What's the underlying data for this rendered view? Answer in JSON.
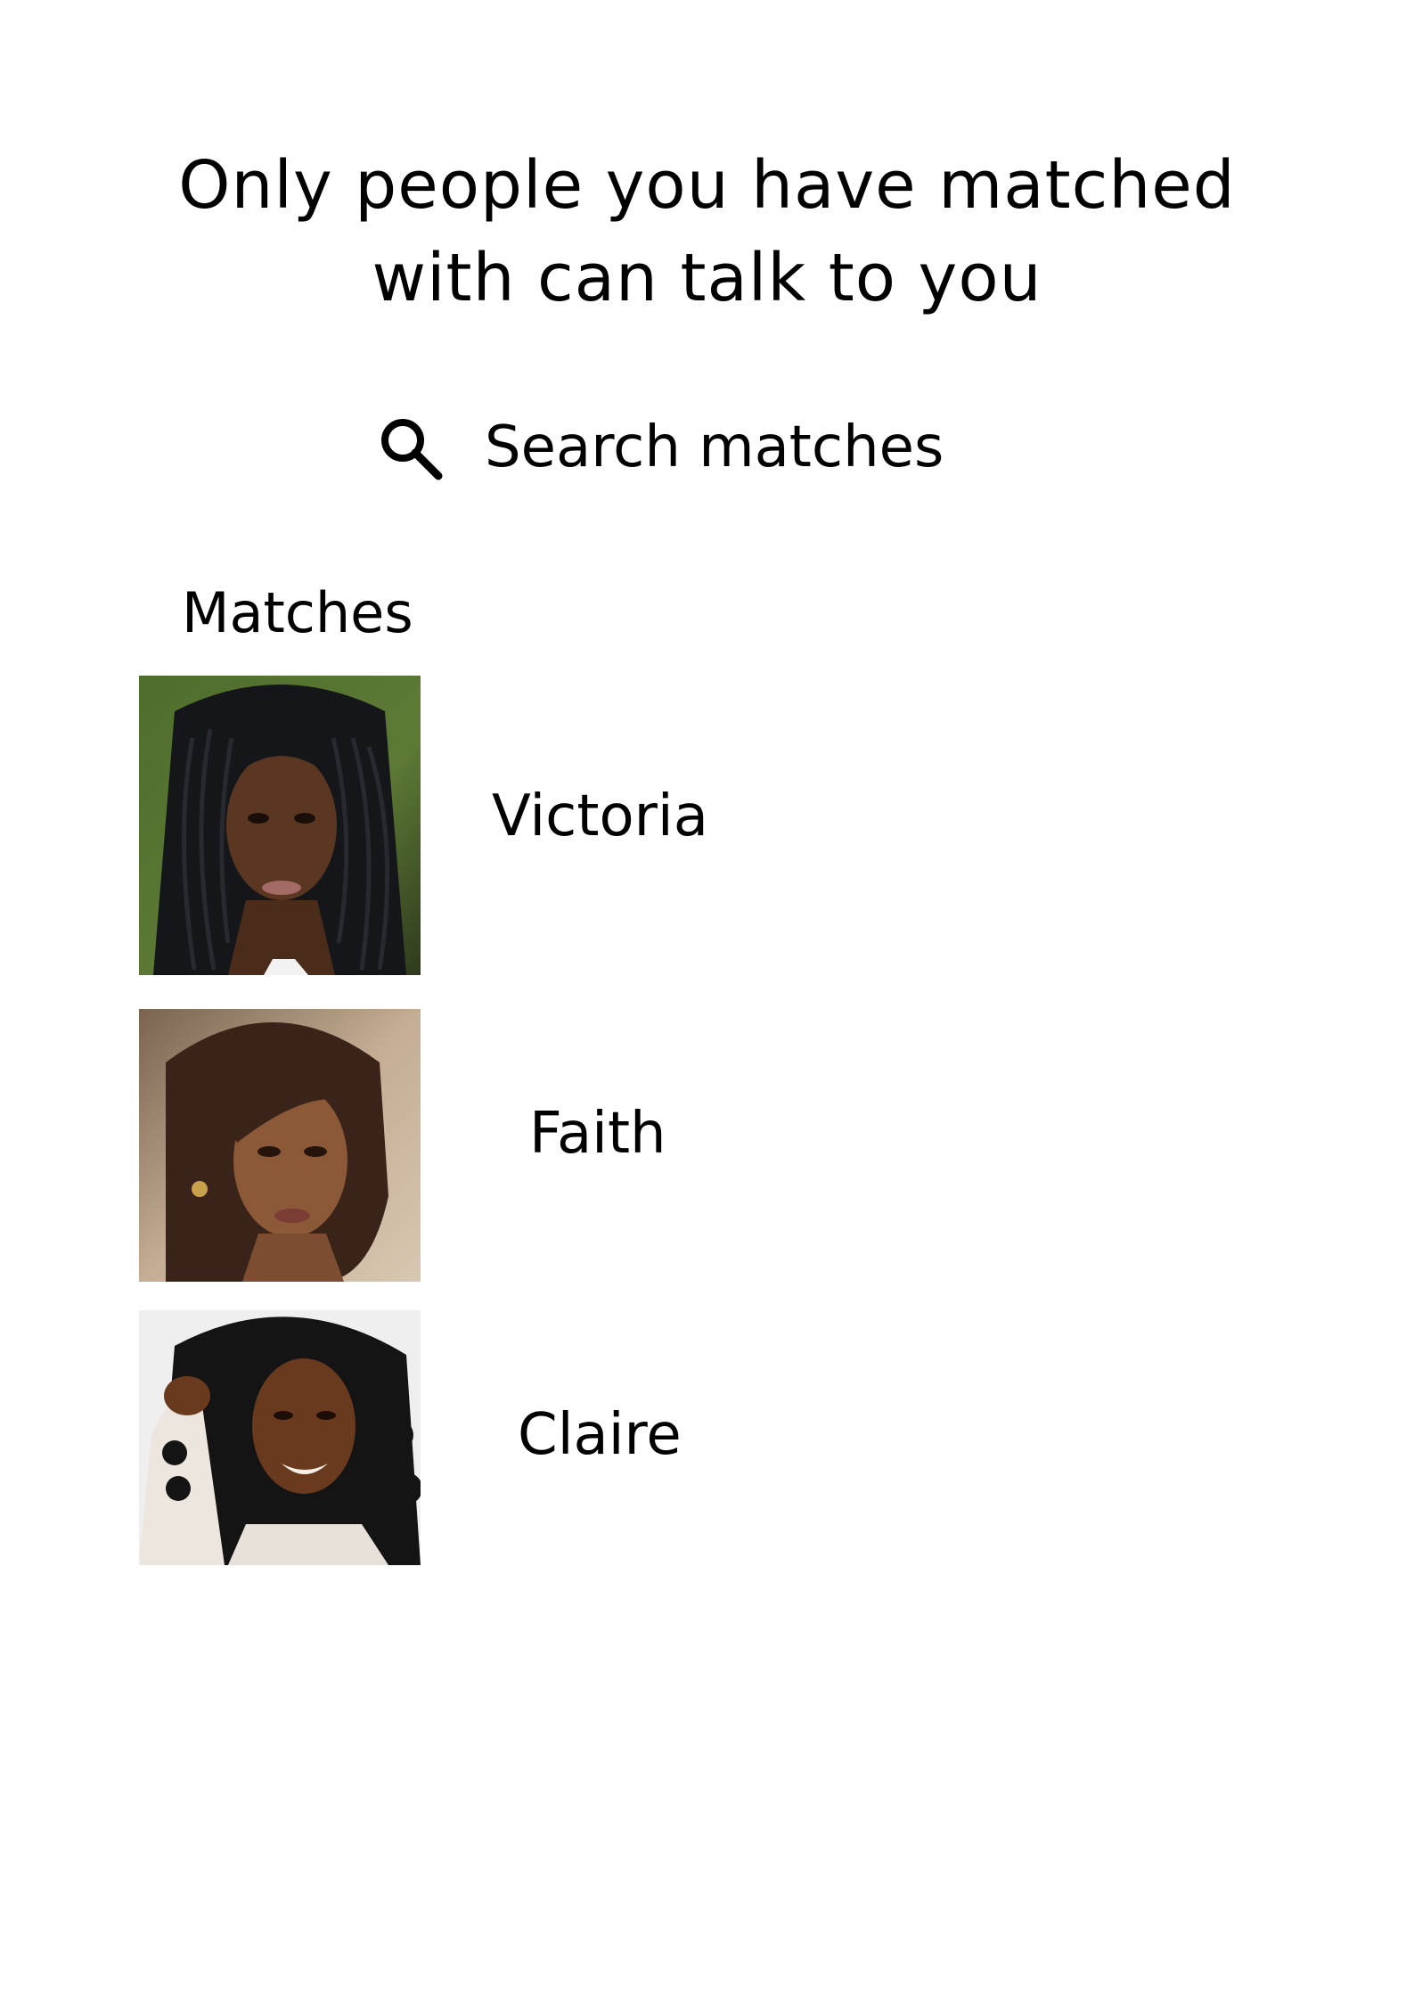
{
  "header": {
    "line1": "Only people you have matched",
    "line2": "with can talk to you"
  },
  "search": {
    "icon": "search-icon",
    "label": "Search matches"
  },
  "matches_section": {
    "title": "Matches",
    "items": [
      {
        "name": "Victoria",
        "photo": "portrait-photo"
      },
      {
        "name": "Faith",
        "photo": "portrait-photo"
      },
      {
        "name": "Claire",
        "photo": "portrait-photo"
      }
    ]
  },
  "colors": {
    "background": "#ffffff",
    "text": "#000000"
  }
}
